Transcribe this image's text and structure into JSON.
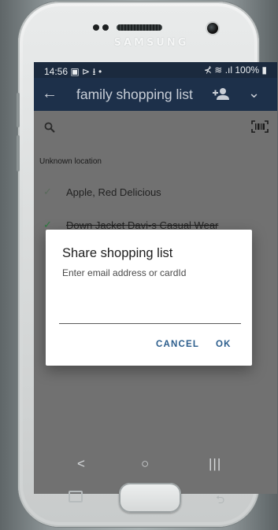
{
  "device": {
    "brand": "SAMSUNG"
  },
  "status_bar": {
    "time": "14:56",
    "left_icons": "▣ ⊳ ⭳ •",
    "right_text": "⊀ ≋ .ıl 100% ▮"
  },
  "app_bar": {
    "title": "family shopping list",
    "back_icon": "←",
    "menu_icon": "⌄"
  },
  "search": {
    "placeholder": ""
  },
  "list": {
    "section_title": "Unknown location",
    "items": [
      {
        "label": "Apple, Red Delicious",
        "checked": true
      },
      {
        "label": "Down Jacket Davi-s Casual Wear",
        "checked": true
      }
    ]
  },
  "dialog": {
    "title": "Share shopping list",
    "message": "Enter email address or cardId",
    "email_value": "",
    "cancel_label": "CANCEL",
    "ok_label": "OK"
  },
  "nav_bar": {
    "back": "<",
    "home": "○",
    "recents": "|||"
  },
  "colors": {
    "app_bar": "#1d304a",
    "status_bar": "#1b2a3e",
    "dialog_button": "#2b5d8c",
    "check_green": "#2c7a3f",
    "scrim": "#717171"
  }
}
